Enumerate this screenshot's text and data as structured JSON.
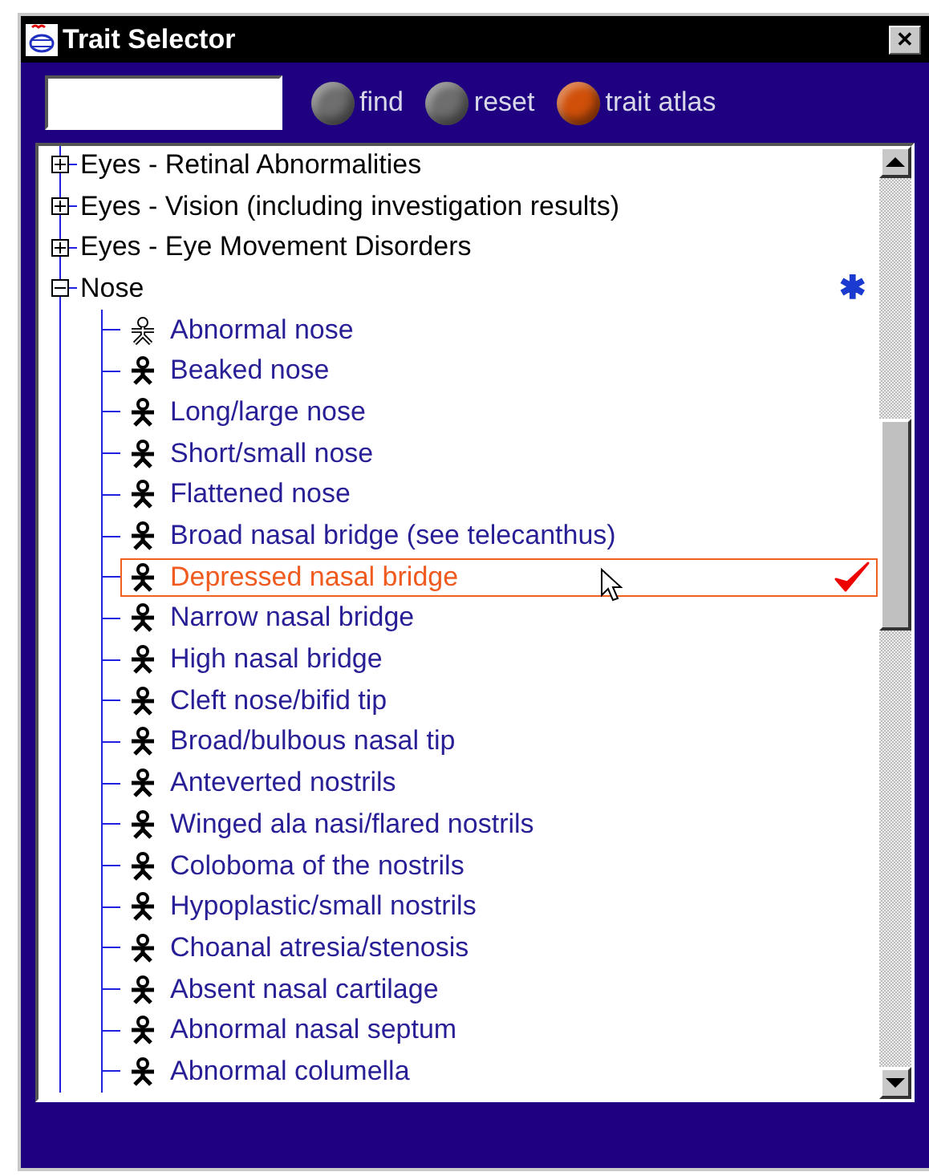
{
  "window": {
    "title": "Trait Selector",
    "close": "✕"
  },
  "toolbar": {
    "buttons": [
      {
        "label": "find",
        "color": "#6e6e6e"
      },
      {
        "label": "reset",
        "color": "#6e6e6e"
      },
      {
        "label": "trait atlas",
        "color": "#d0500a"
      }
    ]
  },
  "tree": {
    "items": [
      {
        "label": "Eyes - Retinal Abnormalities",
        "expanded": false
      },
      {
        "label": "Eyes - Vision (including investigation results)",
        "expanded": false
      },
      {
        "label": "Eyes - Eye Movement Disorders",
        "expanded": false
      },
      {
        "label": "Nose",
        "expanded": true,
        "marker": "✱",
        "children": [
          {
            "label": "Abnormal nose",
            "kind": "outline",
            "selected": false,
            "checked": false
          },
          {
            "label": "Beaked nose",
            "kind": "filled",
            "selected": false,
            "checked": false
          },
          {
            "label": "Long/large nose",
            "kind": "filled",
            "selected": false,
            "checked": false
          },
          {
            "label": "Short/small nose",
            "kind": "filled",
            "selected": false,
            "checked": false
          },
          {
            "label": "Flattened nose",
            "kind": "filled",
            "selected": false,
            "checked": false
          },
          {
            "label": "Broad nasal bridge (see telecanthus)",
            "kind": "filled",
            "selected": false,
            "checked": false
          },
          {
            "label": "Depressed nasal bridge",
            "kind": "filled",
            "selected": true,
            "checked": true
          },
          {
            "label": "Narrow nasal bridge",
            "kind": "filled",
            "selected": false,
            "checked": false
          },
          {
            "label": "High nasal bridge",
            "kind": "filled",
            "selected": false,
            "checked": false
          },
          {
            "label": "Cleft nose/bifid tip",
            "kind": "filled",
            "selected": false,
            "checked": false
          },
          {
            "label": "Broad/bulbous nasal tip",
            "kind": "filled",
            "selected": false,
            "checked": false
          },
          {
            "label": "Anteverted nostrils",
            "kind": "filled",
            "selected": false,
            "checked": false
          },
          {
            "label": "Winged ala nasi/flared nostrils",
            "kind": "filled",
            "selected": false,
            "checked": false
          },
          {
            "label": "Coloboma of the nostrils",
            "kind": "filled",
            "selected": false,
            "checked": false
          },
          {
            "label": "Hypoplastic/small nostrils",
            "kind": "filled",
            "selected": false,
            "checked": false
          },
          {
            "label": "Choanal atresia/stenosis",
            "kind": "filled",
            "selected": false,
            "checked": false
          },
          {
            "label": "Absent nasal cartilage",
            "kind": "filled",
            "selected": false,
            "checked": false
          },
          {
            "label": "Abnormal nasal septum",
            "kind": "filled",
            "selected": false,
            "checked": false
          },
          {
            "label": "Abnormal columella",
            "kind": "filled",
            "selected": false,
            "checked": false
          }
        ]
      }
    ]
  }
}
